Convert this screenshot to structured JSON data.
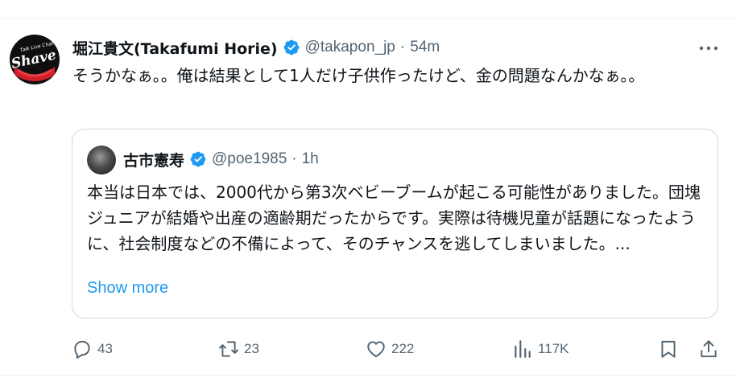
{
  "tweet": {
    "author_name": "堀江貴文(Takafumi Horie)",
    "author_handle": "@takapon_jp",
    "separator": "·",
    "time": "54m",
    "text": "そうかなぁ。。俺は結果として1人だけ子供作ったけど、金の問題なんかなぁ。。",
    "avatar_logo_text": "Shave",
    "avatar_logo_subtext": "Talk Live Chat"
  },
  "quoted_tweet": {
    "author_name": "古市憲寿",
    "author_handle": "@poe1985",
    "separator": "·",
    "time": "1h",
    "text": "本当は日本では、2000代から第3次ベビーブームが起こる可能性がありました。団塊ジュニアが結婚や出産の適齢期だったからです。実際は待機児童が話題になったように、社会制度などの不備によって、そのチャンスを逃してしまいました。...",
    "show_more": "Show more"
  },
  "actions": {
    "replies": "43",
    "retweets": "23",
    "likes": "222",
    "views": "117K"
  },
  "colors": {
    "verified": "#1d9bf0",
    "link": "#1d9bf0",
    "muted": "#536471",
    "border": "#cfd9de"
  },
  "icons": [
    "more-icon",
    "verified-badge-icon",
    "reply-icon",
    "retweet-icon",
    "like-icon",
    "views-icon",
    "bookmark-icon",
    "share-icon"
  ]
}
